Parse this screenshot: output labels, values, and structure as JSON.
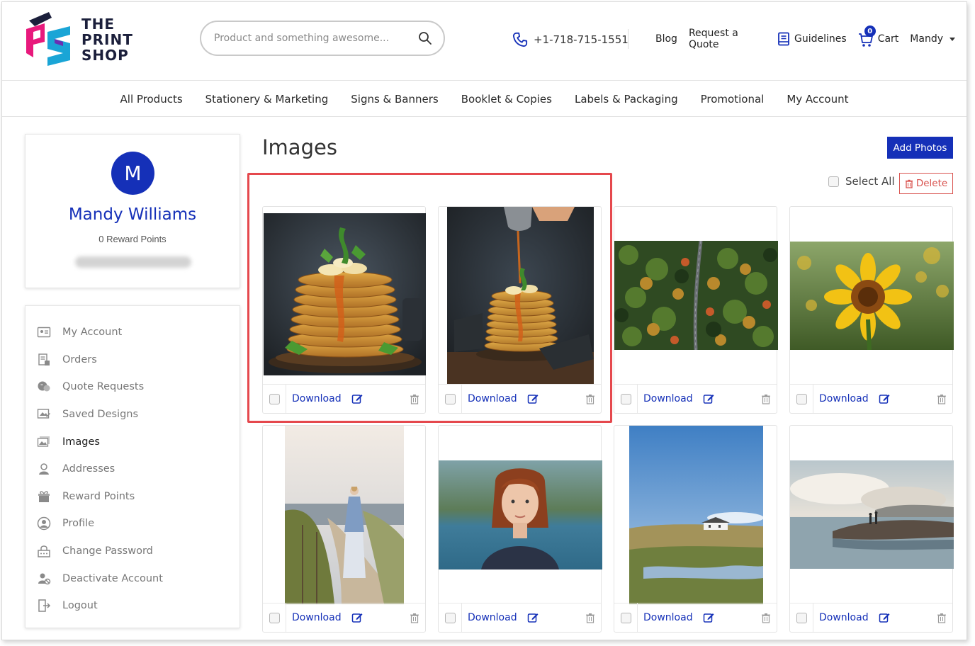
{
  "header": {
    "logo_lines": [
      "THE",
      "PRINT",
      "SHOP"
    ],
    "search_placeholder": "Product and something awesome...",
    "phone": "+1-718-715-1551",
    "links": {
      "blog": "Blog",
      "quote": "Request a Quote",
      "guidelines": "Guidelines",
      "cart": "Cart",
      "cart_count": "0",
      "user": "Mandy"
    }
  },
  "nav": [
    "All Products",
    "Stationery & Marketing",
    "Signs & Banners",
    "Booklet & Copies",
    "Labels & Packaging",
    "Promotional",
    "My Account"
  ],
  "profile": {
    "initial": "M",
    "name": "Mandy Williams",
    "points": "0 Reward Points"
  },
  "menu": [
    {
      "label": "My Account",
      "icon": "id-card-icon"
    },
    {
      "label": "Orders",
      "icon": "orders-icon"
    },
    {
      "label": "Quote Requests",
      "icon": "quote-icon"
    },
    {
      "label": "Saved Designs",
      "icon": "designs-icon"
    },
    {
      "label": "Images",
      "icon": "images-icon",
      "active": true
    },
    {
      "label": "Addresses",
      "icon": "address-icon"
    },
    {
      "label": "Reward Points",
      "icon": "gift-icon"
    },
    {
      "label": "Profile",
      "icon": "profile-icon"
    },
    {
      "label": "Change Password",
      "icon": "lock-icon"
    },
    {
      "label": "Deactivate Account",
      "icon": "deactivate-icon"
    },
    {
      "label": "Logout",
      "icon": "logout-icon"
    }
  ],
  "main": {
    "title": "Images",
    "add_photos": "Add Photos",
    "select_all": "Select All",
    "delete": "Delete"
  },
  "tiles": [
    {
      "subject": "pancakes-syrup",
      "download": "Download"
    },
    {
      "subject": "pancakes-pour",
      "download": "Download"
    },
    {
      "subject": "aerial-forest",
      "download": "Download"
    },
    {
      "subject": "sunflower",
      "download": "Download"
    },
    {
      "subject": "woman-coastal-path",
      "download": "Download"
    },
    {
      "subject": "woman-portrait",
      "download": "Download"
    },
    {
      "subject": "house-meadow",
      "download": "Download"
    },
    {
      "subject": "rocky-lake",
      "download": "Download"
    }
  ],
  "colors": {
    "primary": "#1530b8",
    "danger": "#d9534f",
    "highlight": "#e5484d"
  }
}
